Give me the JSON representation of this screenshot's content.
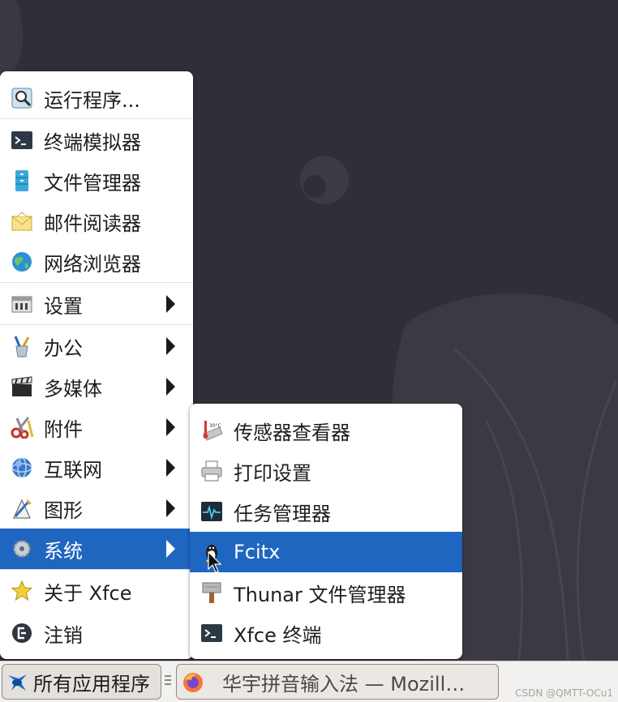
{
  "main_menu": {
    "items": [
      {
        "label": "运行程序...",
        "icon": "search-run-icon",
        "submenu": false
      },
      {
        "label": "终端模拟器",
        "icon": "terminal-icon",
        "submenu": false
      },
      {
        "label": "文件管理器",
        "icon": "file-cabinet-icon",
        "submenu": false
      },
      {
        "label": "邮件阅读器",
        "icon": "mail-envelope-icon",
        "submenu": false
      },
      {
        "label": "网络浏览器",
        "icon": "globe-icon",
        "submenu": false
      },
      {
        "label": "设置",
        "icon": "settings-icon",
        "submenu": true
      },
      {
        "label": "办公",
        "icon": "office-pens-icon",
        "submenu": true
      },
      {
        "label": "多媒体",
        "icon": "clapperboard-icon",
        "submenu": true
      },
      {
        "label": "附件",
        "icon": "scissors-icon",
        "submenu": true
      },
      {
        "label": "互联网",
        "icon": "earth-icon",
        "submenu": true
      },
      {
        "label": "图形",
        "icon": "graphics-icon",
        "submenu": true
      },
      {
        "label": "系统",
        "icon": "gear-icon",
        "submenu": true,
        "active": true
      },
      {
        "label": "关于 Xfce",
        "icon": "star-icon",
        "submenu": false
      },
      {
        "label": "注销",
        "icon": "logout-icon",
        "submenu": false
      }
    ]
  },
  "sub_menu": {
    "items": [
      {
        "label": "传感器查看器",
        "icon": "sensors-thermometer-icon"
      },
      {
        "label": "打印设置",
        "icon": "printer-icon"
      },
      {
        "label": "任务管理器",
        "icon": "task-monitor-icon"
      },
      {
        "label": "Fcitx",
        "icon": "penguin-keyboard-icon",
        "active": true
      },
      {
        "label": "Thunar 文件管理器",
        "icon": "thunar-hammer-icon"
      },
      {
        "label": "Xfce 终端",
        "icon": "terminal-icon"
      }
    ]
  },
  "taskbar": {
    "apps_button_label": "所有应用程序",
    "window_button_label": "华宇拼音输入法 — Mozill…"
  },
  "watermark": "CSDN @QMTT-OCu1",
  "colors": {
    "accent": "#1f66c1",
    "desktop": "#302f37",
    "menu_bg": "#ffffff",
    "taskbar_bg": "#f3f1ef"
  }
}
